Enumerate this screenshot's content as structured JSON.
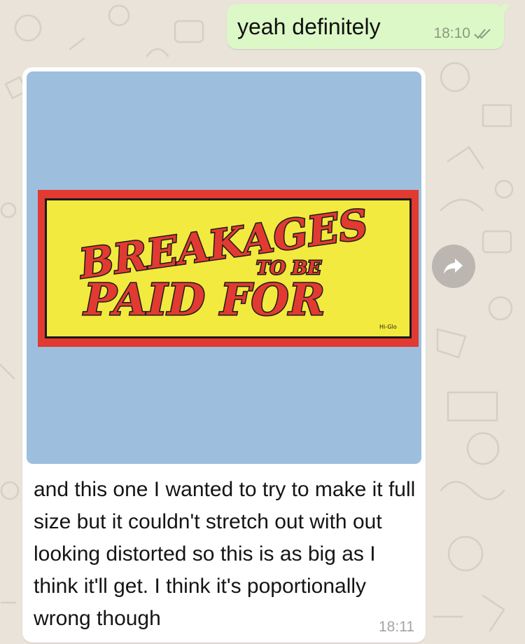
{
  "chat": {
    "outgoing": {
      "text": "yeah definitely",
      "time": "18:10",
      "status_icon": "double-check-icon"
    },
    "incoming": {
      "image": {
        "sign_line1": "BREAKAGES",
        "sign_line2": "TO BE",
        "sign_line3": "PAID  FOR",
        "sign_maker": "Hi-Glo"
      },
      "caption": "and this one I wanted to try to make it full size but it couldn't stretch out with out looking distorted so this is as big as I think it'll get. I think it's poportionally wrong though",
      "time": "18:11"
    },
    "forward_icon": "forward-arrow-icon"
  },
  "colors": {
    "background": "#e9e3d9",
    "outgoing_bubble": "#dcf8c6",
    "incoming_bubble": "#ffffff",
    "photo_background": "#9dbfdd",
    "sign_red": "#e13a32",
    "sign_yellow": "#f2ea3e",
    "forward_button": "#bbb7b0"
  }
}
